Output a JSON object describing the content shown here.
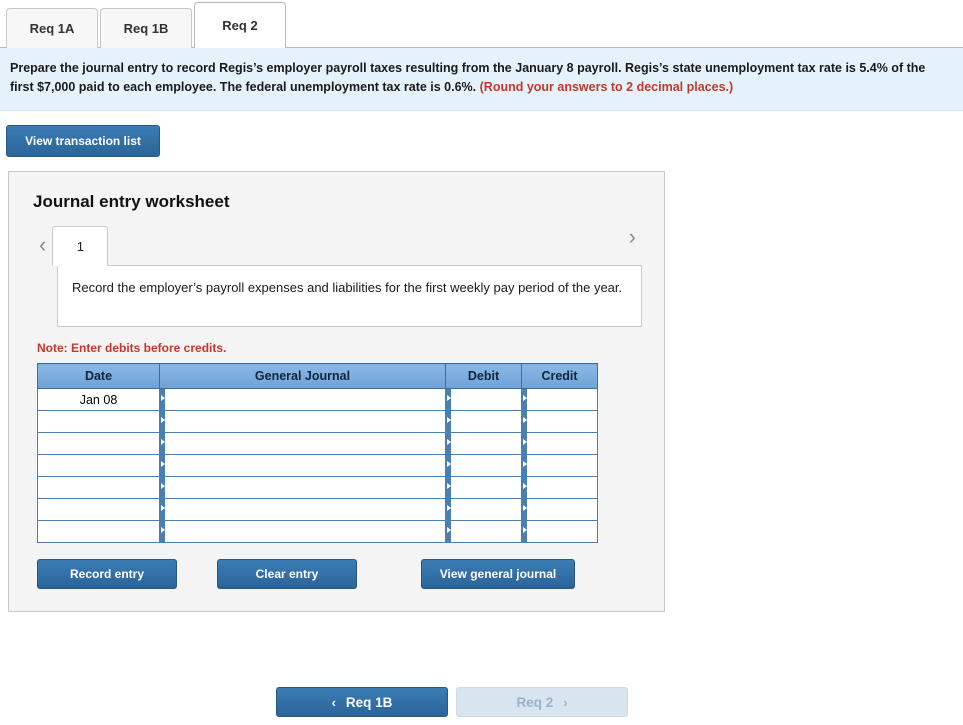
{
  "tabs": [
    {
      "label": "Req 1A",
      "active": false
    },
    {
      "label": "Req 1B",
      "active": false
    },
    {
      "label": "Req 2",
      "active": true
    }
  ],
  "prompt": {
    "text_main": "Prepare the journal entry to record Regis’s employer payroll taxes resulting from the January 8 payroll. Regis’s state unemployment tax rate is 5.4% of the first $7,000 paid to each employee. The federal unemployment tax rate is 0.6%. ",
    "text_note": "(Round your answers to 2 decimal places.)"
  },
  "toolbar": {
    "view_transaction_list": "View transaction list"
  },
  "worksheet": {
    "title": "Journal entry worksheet",
    "page_number": "1",
    "prev_arrow": "‹",
    "next_arrow": "›",
    "description": "Record the employer’s payroll expenses and liabilities for the first weekly pay period of the year.",
    "note": "Note: Enter debits before credits.",
    "table": {
      "headers": [
        "Date",
        "General Journal",
        "Debit",
        "Credit"
      ],
      "rows": [
        {
          "date": "Jan 08",
          "account": "",
          "debit": "",
          "credit": ""
        },
        {
          "date": "",
          "account": "",
          "debit": "",
          "credit": ""
        },
        {
          "date": "",
          "account": "",
          "debit": "",
          "credit": ""
        },
        {
          "date": "",
          "account": "",
          "debit": "",
          "credit": ""
        },
        {
          "date": "",
          "account": "",
          "debit": "",
          "credit": ""
        },
        {
          "date": "",
          "account": "",
          "debit": "",
          "credit": ""
        },
        {
          "date": "",
          "account": "",
          "debit": "",
          "credit": ""
        }
      ]
    },
    "buttons": {
      "record_entry": "Record entry",
      "clear_entry": "Clear entry",
      "view_general_journal": "View general journal"
    }
  },
  "footer": {
    "prev_label": "Req 1B",
    "prev_arrow": "‹",
    "next_label": "Req 2",
    "next_arrow": "›"
  },
  "colors": {
    "accent_blue": "#2e6da4",
    "banner_blue": "#e5f2fb",
    "header_blue": "#7cacde",
    "note_red": "#c0392b"
  }
}
